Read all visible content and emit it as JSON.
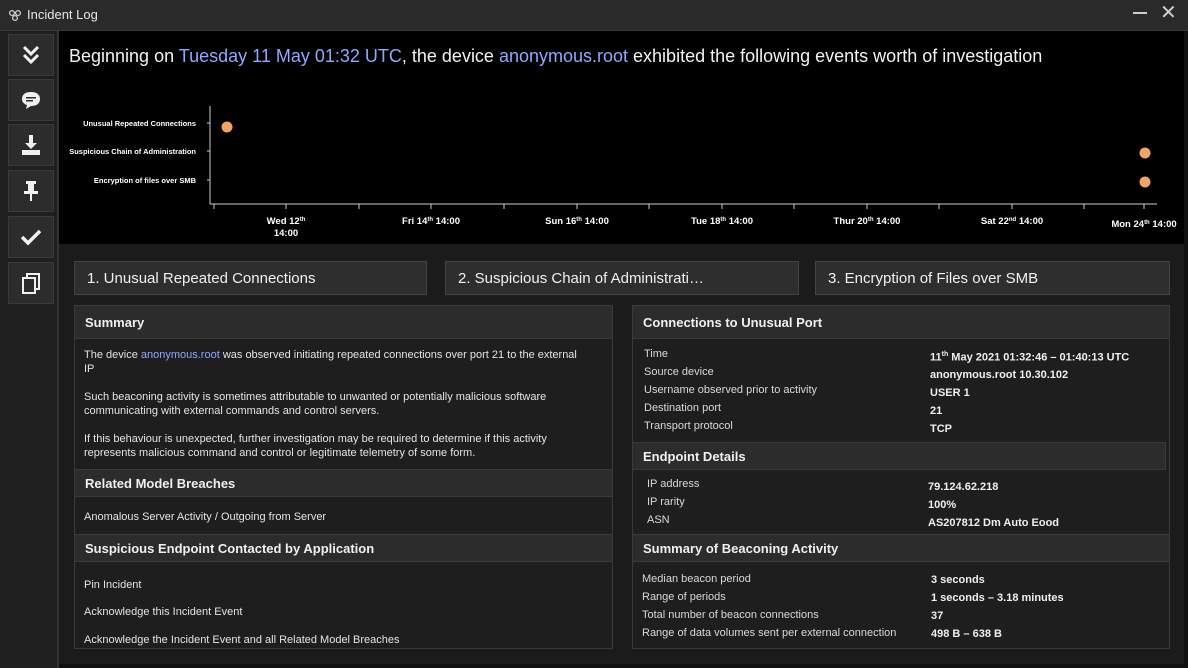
{
  "window": {
    "title": "Incident Log",
    "app_icon": "gear-cluster-icon",
    "close_glyph": "✕"
  },
  "sidebar": {
    "buttons": [
      {
        "name": "collapse-button",
        "icon": "double-chevron-down-icon"
      },
      {
        "name": "comment-button",
        "icon": "chat-bubble-icon"
      },
      {
        "name": "download-button",
        "icon": "download-icon"
      },
      {
        "name": "pin-button",
        "icon": "pin-icon"
      },
      {
        "name": "acknowledge-button",
        "icon": "checkmark-icon"
      },
      {
        "name": "copy-button",
        "icon": "copy-icon"
      }
    ]
  },
  "headline": {
    "prefix": "Beginning on ",
    "date": "Tuesday 11 May 01:32 UTC",
    "middle": ", the device ",
    "device": "anonymous.root",
    "suffix": " exhibited the following events worth of investigation"
  },
  "chart_data": {
    "type": "scatter",
    "categories": [
      "Unusual Repeated Connections",
      "Suspicious Chain of Administration",
      "Encryption of files over SMB"
    ],
    "x_ticks": [
      {
        "day": "Wed 12",
        "sup": "th",
        "time": "14:00"
      },
      {
        "day": "Fri 14",
        "sup": "th",
        "time": "14:00"
      },
      {
        "day": "Sun 16",
        "sup": "th",
        "time": "14:00"
      },
      {
        "day": "Tue 18",
        "sup": "th",
        "time": "14:00"
      },
      {
        "day": "Thur 20",
        "sup": "th",
        "time": "14:00"
      },
      {
        "day": "Sat 22",
        "sup": "nd",
        "time": "14:00"
      },
      {
        "day": "Mon 24",
        "sup": "th",
        "time": "14:00"
      }
    ],
    "points": [
      {
        "category": "Unusual Repeated Connections",
        "time": "11 May 01:32 UTC"
      },
      {
        "category": "Suspicious Chain of Administration",
        "time": "24 May ~11:00"
      },
      {
        "category": "Encryption of files over SMB",
        "time": "24 May ~11:00"
      }
    ],
    "point_color": "#f4a462"
  },
  "tabs": [
    "1. Unusual Repeated Connections",
    "2. Suspicious Chain of Administrati…",
    "3. Encryption of Files over SMB"
  ],
  "summary": {
    "title": "Summary",
    "p1_pre": "The device ",
    "p1_device": "anonymous.root",
    "p1_post": " was observed initiating repeated connections over port 21 to the external IP",
    "p2": "Such beaconing activity is sometimes attributable to unwanted or potentially malicious software communicating with external commands and control servers.",
    "p3": "If this behaviour is unexpected, further investigation may be required to determine if this activity represents malicious command and control or legitimate telemetry of some form."
  },
  "related": {
    "title": "Related Model Breaches",
    "item": "Anomalous Server Activity / Outgoing from Server"
  },
  "suspicious": {
    "title": "Suspicious Endpoint Contacted by Application",
    "actions": [
      "Pin Incident",
      "Acknowledge this Incident Event",
      "Acknowledge the Incident Event and all Related Model Breaches"
    ]
  },
  "connections": {
    "title": "Connections to Unusual Port",
    "rows": [
      {
        "k": "Time",
        "v": "11th May 2021 01:32:46 – 01:40:13 UTC"
      },
      {
        "k": "Source device",
        "v": "anonymous.root 10.30.102"
      },
      {
        "k": "Username observed prior to activity",
        "v": "USER 1"
      },
      {
        "k": "Destination port",
        "v": "21"
      },
      {
        "k": "Transport protocol",
        "v": "TCP"
      }
    ]
  },
  "endpoint": {
    "title": "Endpoint Details",
    "rows": [
      {
        "k": "IP address",
        "v": "79.124.62.218"
      },
      {
        "k": "IP rarity",
        "v": "100%"
      },
      {
        "k": "ASN",
        "v": "AS207812 Dm Auto Eood"
      }
    ]
  },
  "beaconing": {
    "title": "Summary of Beaconing Activity",
    "rows": [
      {
        "k": "Median beacon period",
        "v": "3 seconds"
      },
      {
        "k": "Range of periods",
        "v": "1 seconds – 3.18 minutes"
      },
      {
        "k": "Total number of beacon connections",
        "v": "37"
      },
      {
        "k": "Range of data volumes sent per external connection",
        "v": "498 B – 638 B"
      }
    ]
  }
}
